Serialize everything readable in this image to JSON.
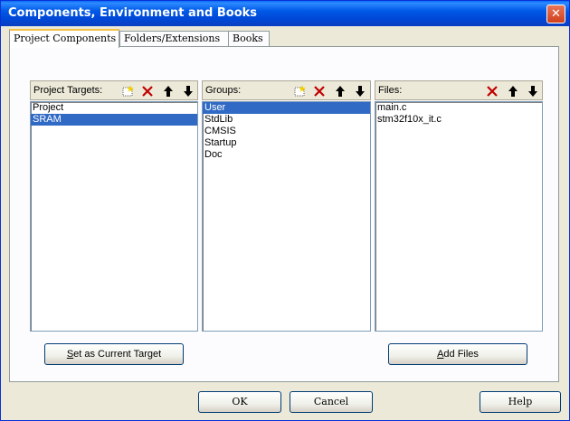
{
  "window": {
    "title": "Components, Environment and Books",
    "close_glyph": "✕"
  },
  "tabs": [
    {
      "label": "Project Components",
      "active": true
    },
    {
      "label": "Folders/Extensions",
      "active": false
    },
    {
      "label": "Books",
      "active": false
    }
  ],
  "targets": {
    "label": "Project Targets:",
    "items": [
      {
        "text": "Project",
        "selected": false
      },
      {
        "text": "SRAM",
        "selected": true
      }
    ],
    "buttons": [
      "new-icon",
      "delete-icon",
      "move-up-icon",
      "move-down-icon"
    ]
  },
  "groups": {
    "label": "Groups:",
    "items": [
      {
        "text": "User",
        "selected": true
      },
      {
        "text": "StdLib",
        "selected": false
      },
      {
        "text": "CMSIS",
        "selected": false
      },
      {
        "text": "Startup",
        "selected": false
      },
      {
        "text": "Doc",
        "selected": false
      }
    ],
    "buttons": [
      "new-icon",
      "delete-icon",
      "move-up-icon",
      "move-down-icon"
    ]
  },
  "files": {
    "label": "Files:",
    "items": [
      {
        "text": "main.c",
        "selected": false
      },
      {
        "text": "stm32f10x_it.c",
        "selected": false
      }
    ],
    "buttons": [
      "delete-icon",
      "move-up-icon",
      "move-down-icon"
    ]
  },
  "actions": {
    "set_target_mnemonic": "S",
    "set_target_rest": "et as Current Target",
    "add_files_mnemonic": "A",
    "add_files_rest": "dd Files"
  },
  "dialog": {
    "ok": "OK",
    "cancel": "Cancel",
    "help": "Help"
  },
  "colors": {
    "selection": "#316ac5",
    "title_bar": "#0058e6",
    "dialog_bg": "#ece9d8"
  }
}
